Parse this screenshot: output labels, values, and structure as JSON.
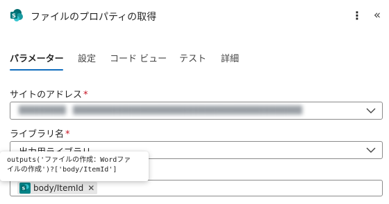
{
  "header": {
    "title": "ファイルのプロパティの取得",
    "app_icon": "sharepoint-icon",
    "more_icon": "more-vertical-icon",
    "collapse_icon": "collapse-panel-icon"
  },
  "tabs": [
    {
      "label": "パラメーター",
      "active": true
    },
    {
      "label": "設定",
      "active": false
    },
    {
      "label": "コード ビュー",
      "active": false
    },
    {
      "label": "テスト",
      "active": false
    },
    {
      "label": "詳細",
      "active": false
    }
  ],
  "fields": {
    "site": {
      "label": "サイトのアドレス",
      "required_mark": "*"
    },
    "library": {
      "label": "ライブラリ名",
      "required_mark": "*",
      "value": "出力用ライブラリ"
    },
    "id": {
      "token_label": "body/ItemId",
      "token_close": "✕"
    }
  },
  "tooltip": {
    "line1": "outputs('ファイルの作成：Wordファ",
    "line2": "イルの作成')?['body/ItemId']"
  },
  "colors": {
    "accent": "#0f6cbd",
    "required": "#c50f1f",
    "sharepoint": "#038387"
  }
}
